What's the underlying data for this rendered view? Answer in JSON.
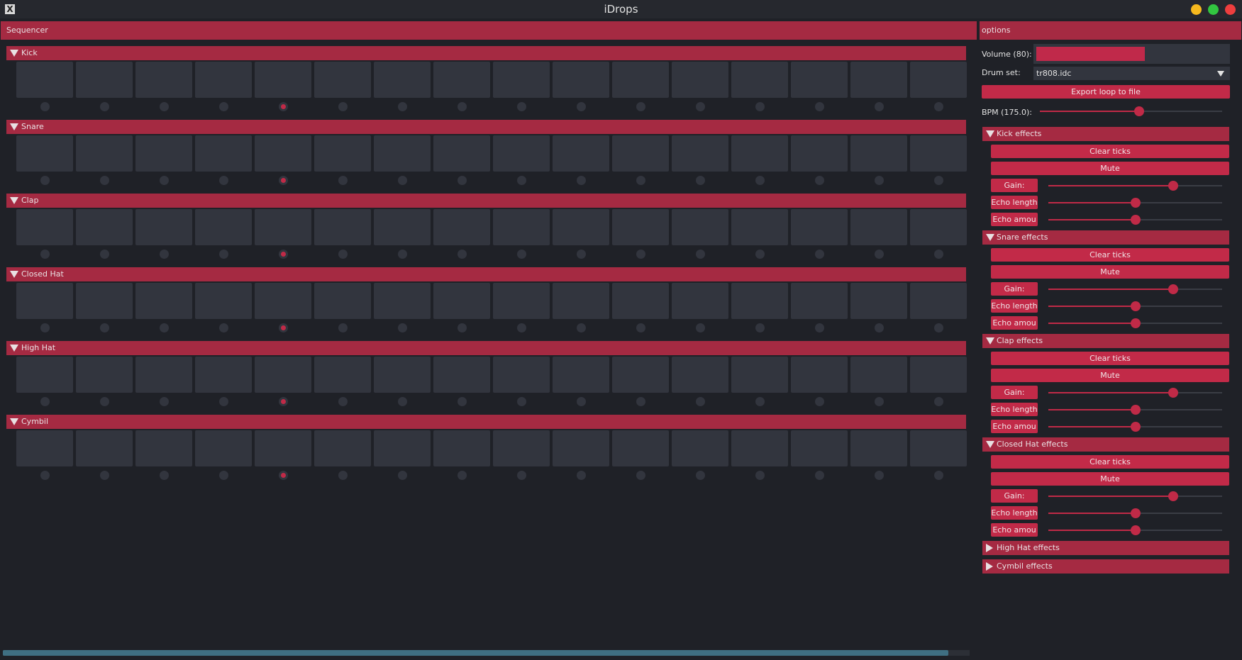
{
  "window": {
    "title": "iDrops",
    "app_icon": "X"
  },
  "sequencer": {
    "header": "Sequencer",
    "active_step": 5,
    "tracks": [
      {
        "name": "Kick"
      },
      {
        "name": "Snare"
      },
      {
        "name": "Clap"
      },
      {
        "name": "Closed Hat"
      },
      {
        "name": "High Hat"
      },
      {
        "name": "Cymbil"
      }
    ]
  },
  "options": {
    "header": "options",
    "volume_label": "Volume (80):",
    "volume_value": 80,
    "drumset_label": "Drum set:",
    "drumset_value": "tr808.idc",
    "export_label": "Export loop to file",
    "bpm_label": "BPM (175.0):",
    "bpm_value": 175.0,
    "effects": [
      {
        "title": "Kick effects",
        "expanded": true,
        "clear_label": "Clear ticks",
        "mute_label": "Mute",
        "gain_label": "Gain:",
        "echo_length_label": "Echo length",
        "echo_amount_label": "Echo amou",
        "gain": 0.72,
        "echo_length": 0.5,
        "echo_amount": 0.5
      },
      {
        "title": "Snare effects",
        "expanded": true,
        "clear_label": "Clear ticks",
        "mute_label": "Mute",
        "gain_label": "Gain:",
        "echo_length_label": "Echo length",
        "echo_amount_label": "Echo amou",
        "gain": 0.72,
        "echo_length": 0.5,
        "echo_amount": 0.5
      },
      {
        "title": "Clap effects",
        "expanded": true,
        "clear_label": "Clear ticks",
        "mute_label": "Mute",
        "gain_label": "Gain:",
        "echo_length_label": "Echo length",
        "echo_amount_label": "Echo amou",
        "gain": 0.72,
        "echo_length": 0.5,
        "echo_amount": 0.5
      },
      {
        "title": "Closed Hat effects",
        "expanded": true,
        "clear_label": "Clear ticks",
        "mute_label": "Mute",
        "gain_label": "Gain:",
        "echo_length_label": "Echo length",
        "echo_amount_label": "Echo amou",
        "gain": 0.72,
        "echo_length": 0.5,
        "echo_amount": 0.5
      },
      {
        "title": "High Hat effects",
        "expanded": false
      },
      {
        "title": "Cymbil effects",
        "expanded": false
      }
    ]
  },
  "colors": {
    "accent": "#c22a48",
    "header": "#a52a42",
    "background": "#1f2127",
    "pad": "#32353e"
  }
}
